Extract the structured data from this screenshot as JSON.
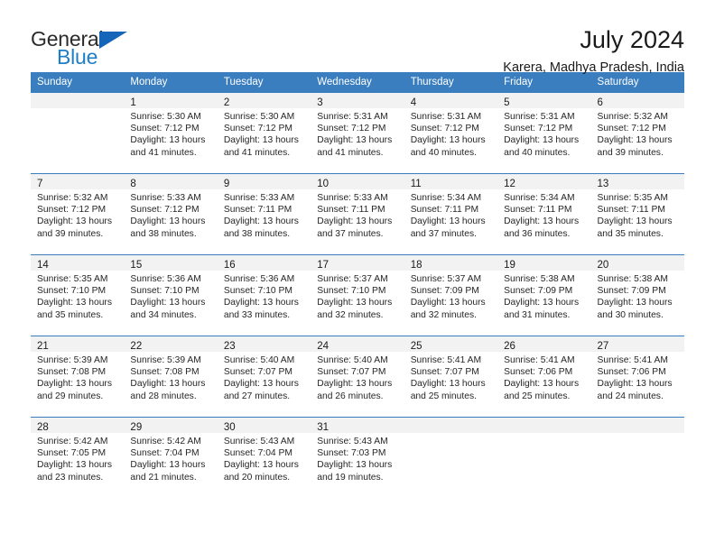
{
  "brand": {
    "name_part1": "General",
    "name_part2": "Blue",
    "accent_color": "#1f7ec4",
    "triangle_color": "#1565b8"
  },
  "header": {
    "title": "July 2024",
    "subtitle": "Karera, Madhya Pradesh, India"
  },
  "calendar": {
    "header_bg": "#3a7ebf",
    "daynum_bg": "#f2f2f2",
    "weekdays": [
      "Sunday",
      "Monday",
      "Tuesday",
      "Wednesday",
      "Thursday",
      "Friday",
      "Saturday"
    ],
    "weeks": [
      [
        {
          "day": "",
          "sunrise": "",
          "sunset": "",
          "daylight1": "",
          "daylight2": "",
          "empty": true
        },
        {
          "day": "1",
          "sunrise": "Sunrise: 5:30 AM",
          "sunset": "Sunset: 7:12 PM",
          "daylight1": "Daylight: 13 hours",
          "daylight2": "and 41 minutes.",
          "empty": false
        },
        {
          "day": "2",
          "sunrise": "Sunrise: 5:30 AM",
          "sunset": "Sunset: 7:12 PM",
          "daylight1": "Daylight: 13 hours",
          "daylight2": "and 41 minutes.",
          "empty": false
        },
        {
          "day": "3",
          "sunrise": "Sunrise: 5:31 AM",
          "sunset": "Sunset: 7:12 PM",
          "daylight1": "Daylight: 13 hours",
          "daylight2": "and 41 minutes.",
          "empty": false
        },
        {
          "day": "4",
          "sunrise": "Sunrise: 5:31 AM",
          "sunset": "Sunset: 7:12 PM",
          "daylight1": "Daylight: 13 hours",
          "daylight2": "and 40 minutes.",
          "empty": false
        },
        {
          "day": "5",
          "sunrise": "Sunrise: 5:31 AM",
          "sunset": "Sunset: 7:12 PM",
          "daylight1": "Daylight: 13 hours",
          "daylight2": "and 40 minutes.",
          "empty": false
        },
        {
          "day": "6",
          "sunrise": "Sunrise: 5:32 AM",
          "sunset": "Sunset: 7:12 PM",
          "daylight1": "Daylight: 13 hours",
          "daylight2": "and 39 minutes.",
          "empty": false
        }
      ],
      [
        {
          "day": "7",
          "sunrise": "Sunrise: 5:32 AM",
          "sunset": "Sunset: 7:12 PM",
          "daylight1": "Daylight: 13 hours",
          "daylight2": "and 39 minutes.",
          "empty": false
        },
        {
          "day": "8",
          "sunrise": "Sunrise: 5:33 AM",
          "sunset": "Sunset: 7:12 PM",
          "daylight1": "Daylight: 13 hours",
          "daylight2": "and 38 minutes.",
          "empty": false
        },
        {
          "day": "9",
          "sunrise": "Sunrise: 5:33 AM",
          "sunset": "Sunset: 7:11 PM",
          "daylight1": "Daylight: 13 hours",
          "daylight2": "and 38 minutes.",
          "empty": false
        },
        {
          "day": "10",
          "sunrise": "Sunrise: 5:33 AM",
          "sunset": "Sunset: 7:11 PM",
          "daylight1": "Daylight: 13 hours",
          "daylight2": "and 37 minutes.",
          "empty": false
        },
        {
          "day": "11",
          "sunrise": "Sunrise: 5:34 AM",
          "sunset": "Sunset: 7:11 PM",
          "daylight1": "Daylight: 13 hours",
          "daylight2": "and 37 minutes.",
          "empty": false
        },
        {
          "day": "12",
          "sunrise": "Sunrise: 5:34 AM",
          "sunset": "Sunset: 7:11 PM",
          "daylight1": "Daylight: 13 hours",
          "daylight2": "and 36 minutes.",
          "empty": false
        },
        {
          "day": "13",
          "sunrise": "Sunrise: 5:35 AM",
          "sunset": "Sunset: 7:11 PM",
          "daylight1": "Daylight: 13 hours",
          "daylight2": "and 35 minutes.",
          "empty": false
        }
      ],
      [
        {
          "day": "14",
          "sunrise": "Sunrise: 5:35 AM",
          "sunset": "Sunset: 7:10 PM",
          "daylight1": "Daylight: 13 hours",
          "daylight2": "and 35 minutes.",
          "empty": false
        },
        {
          "day": "15",
          "sunrise": "Sunrise: 5:36 AM",
          "sunset": "Sunset: 7:10 PM",
          "daylight1": "Daylight: 13 hours",
          "daylight2": "and 34 minutes.",
          "empty": false
        },
        {
          "day": "16",
          "sunrise": "Sunrise: 5:36 AM",
          "sunset": "Sunset: 7:10 PM",
          "daylight1": "Daylight: 13 hours",
          "daylight2": "and 33 minutes.",
          "empty": false
        },
        {
          "day": "17",
          "sunrise": "Sunrise: 5:37 AM",
          "sunset": "Sunset: 7:10 PM",
          "daylight1": "Daylight: 13 hours",
          "daylight2": "and 32 minutes.",
          "empty": false
        },
        {
          "day": "18",
          "sunrise": "Sunrise: 5:37 AM",
          "sunset": "Sunset: 7:09 PM",
          "daylight1": "Daylight: 13 hours",
          "daylight2": "and 32 minutes.",
          "empty": false
        },
        {
          "day": "19",
          "sunrise": "Sunrise: 5:38 AM",
          "sunset": "Sunset: 7:09 PM",
          "daylight1": "Daylight: 13 hours",
          "daylight2": "and 31 minutes.",
          "empty": false
        },
        {
          "day": "20",
          "sunrise": "Sunrise: 5:38 AM",
          "sunset": "Sunset: 7:09 PM",
          "daylight1": "Daylight: 13 hours",
          "daylight2": "and 30 minutes.",
          "empty": false
        }
      ],
      [
        {
          "day": "21",
          "sunrise": "Sunrise: 5:39 AM",
          "sunset": "Sunset: 7:08 PM",
          "daylight1": "Daylight: 13 hours",
          "daylight2": "and 29 minutes.",
          "empty": false
        },
        {
          "day": "22",
          "sunrise": "Sunrise: 5:39 AM",
          "sunset": "Sunset: 7:08 PM",
          "daylight1": "Daylight: 13 hours",
          "daylight2": "and 28 minutes.",
          "empty": false
        },
        {
          "day": "23",
          "sunrise": "Sunrise: 5:40 AM",
          "sunset": "Sunset: 7:07 PM",
          "daylight1": "Daylight: 13 hours",
          "daylight2": "and 27 minutes.",
          "empty": false
        },
        {
          "day": "24",
          "sunrise": "Sunrise: 5:40 AM",
          "sunset": "Sunset: 7:07 PM",
          "daylight1": "Daylight: 13 hours",
          "daylight2": "and 26 minutes.",
          "empty": false
        },
        {
          "day": "25",
          "sunrise": "Sunrise: 5:41 AM",
          "sunset": "Sunset: 7:07 PM",
          "daylight1": "Daylight: 13 hours",
          "daylight2": "and 25 minutes.",
          "empty": false
        },
        {
          "day": "26",
          "sunrise": "Sunrise: 5:41 AM",
          "sunset": "Sunset: 7:06 PM",
          "daylight1": "Daylight: 13 hours",
          "daylight2": "and 25 minutes.",
          "empty": false
        },
        {
          "day": "27",
          "sunrise": "Sunrise: 5:41 AM",
          "sunset": "Sunset: 7:06 PM",
          "daylight1": "Daylight: 13 hours",
          "daylight2": "and 24 minutes.",
          "empty": false
        }
      ],
      [
        {
          "day": "28",
          "sunrise": "Sunrise: 5:42 AM",
          "sunset": "Sunset: 7:05 PM",
          "daylight1": "Daylight: 13 hours",
          "daylight2": "and 23 minutes.",
          "empty": false
        },
        {
          "day": "29",
          "sunrise": "Sunrise: 5:42 AM",
          "sunset": "Sunset: 7:04 PM",
          "daylight1": "Daylight: 13 hours",
          "daylight2": "and 21 minutes.",
          "empty": false
        },
        {
          "day": "30",
          "sunrise": "Sunrise: 5:43 AM",
          "sunset": "Sunset: 7:04 PM",
          "daylight1": "Daylight: 13 hours",
          "daylight2": "and 20 minutes.",
          "empty": false
        },
        {
          "day": "31",
          "sunrise": "Sunrise: 5:43 AM",
          "sunset": "Sunset: 7:03 PM",
          "daylight1": "Daylight: 13 hours",
          "daylight2": "and 19 minutes.",
          "empty": false
        },
        {
          "day": "",
          "sunrise": "",
          "sunset": "",
          "daylight1": "",
          "daylight2": "",
          "empty": true
        },
        {
          "day": "",
          "sunrise": "",
          "sunset": "",
          "daylight1": "",
          "daylight2": "",
          "empty": true
        },
        {
          "day": "",
          "sunrise": "",
          "sunset": "",
          "daylight1": "",
          "daylight2": "",
          "empty": true
        }
      ]
    ]
  }
}
